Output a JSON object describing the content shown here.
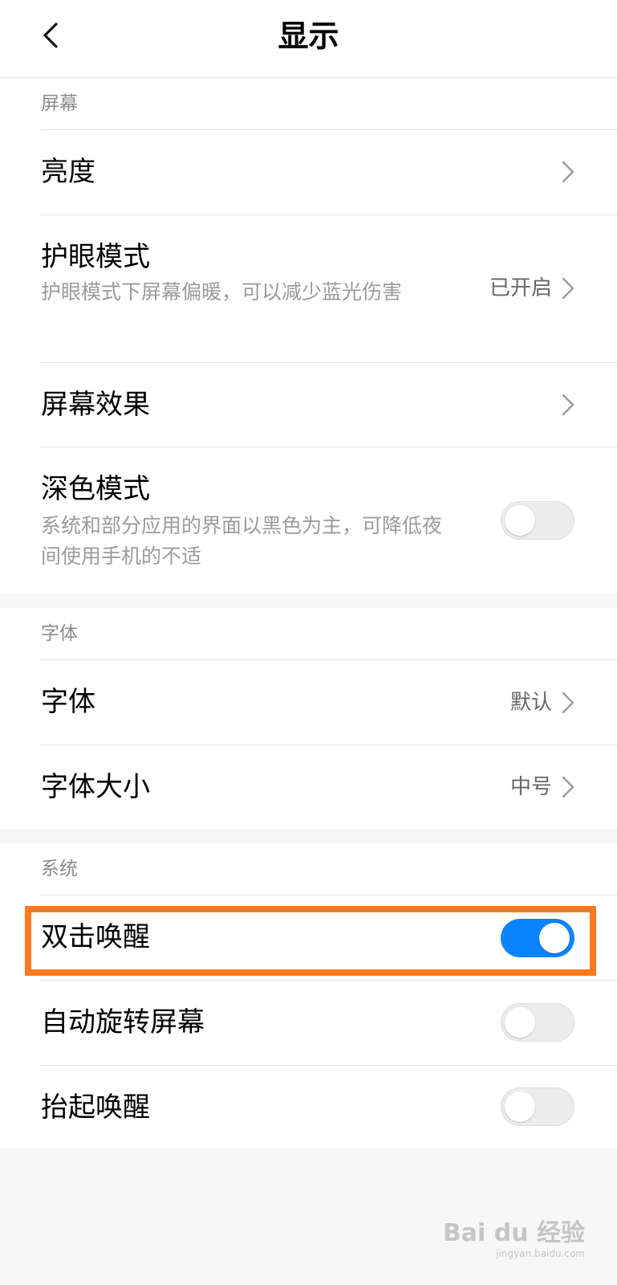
{
  "header": {
    "title": "显示",
    "back_icon": "chevron-left-icon"
  },
  "sections": {
    "screen": {
      "label": "屏幕",
      "brightness": {
        "title": "亮度"
      },
      "eye_care": {
        "title": "护眼模式",
        "desc": "护眼模式下屏幕偏暖，可以减少蓝光伤害",
        "value": "已开启"
      },
      "screen_effect": {
        "title": "屏幕效果"
      },
      "dark_mode": {
        "title": "深色模式",
        "desc": "系统和部分应用的界面以黑色为主，可降低夜间使用手机的不适",
        "enabled": false
      }
    },
    "font": {
      "label": "字体",
      "font": {
        "title": "字体",
        "value": "默认"
      },
      "font_size": {
        "title": "字体大小",
        "value": "中号"
      }
    },
    "system": {
      "label": "系统",
      "double_tap_wake": {
        "title": "双击唤醒",
        "enabled": true
      },
      "auto_rotate": {
        "title": "自动旋转屏幕",
        "enabled": false
      },
      "raise_to_wake": {
        "title": "抬起唤醒",
        "enabled": false
      }
    }
  },
  "colors": {
    "toggle_on": "#0d84ff",
    "highlight": "#ff7a1f"
  },
  "watermark": {
    "text": "Bai du 经验",
    "sub": "jingyan.baidu.com"
  }
}
